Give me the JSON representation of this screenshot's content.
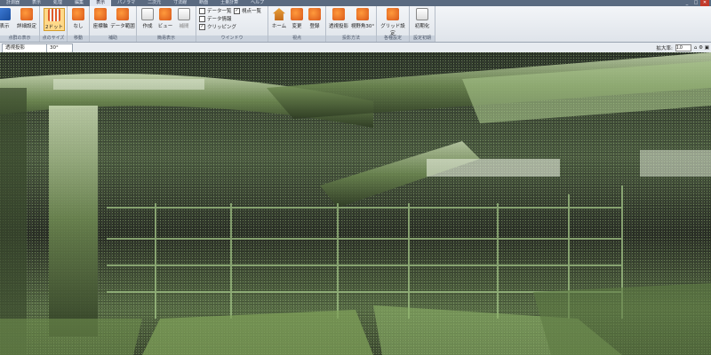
{
  "window": {
    "tabs": [
      "計測器",
      "表示",
      "処理",
      "編集",
      "表示",
      "パノラマ",
      "二次元",
      "寸法線",
      "断面",
      "土量計算",
      "ヘルプ"
    ],
    "active_tab_index": 4
  },
  "ribbon": {
    "groups": [
      {
        "caption": "点群の表示",
        "buttons": [
          "表示",
          "詳細設定"
        ]
      },
      {
        "caption": "点のサイズ",
        "buttons": [
          "2ドット"
        ]
      },
      {
        "caption": "移動",
        "buttons": [
          "なし"
        ]
      },
      {
        "caption": "補助",
        "buttons": [
          "座標軸",
          "データ範囲"
        ]
      },
      {
        "caption": "簡易表示",
        "buttons": [
          "作成",
          "ビュー",
          "補間"
        ]
      },
      {
        "caption": "ウインドウ",
        "checks": [
          {
            "label": "データ一覧",
            "checked": false
          },
          {
            "label": "視点一覧",
            "checked": true
          },
          {
            "label": "データ情報",
            "checked": false
          },
          {
            "label": "クリッピング",
            "checked": true
          }
        ]
      },
      {
        "caption": "視点",
        "buttons": [
          "ホーム",
          "変更",
          "登録"
        ]
      },
      {
        "caption": "投影方法",
        "buttons": [
          "透視投影",
          "視野角30°"
        ]
      },
      {
        "caption": "各種設定",
        "buttons": [
          "グリッド設定"
        ]
      },
      {
        "caption": "設定初期",
        "buttons": [
          "初期化"
        ]
      }
    ]
  },
  "tabrow": {
    "doc_tab": "透視投影",
    "doc_tab2": "30°",
    "zoom_label": "拡大率:",
    "zoom_value": "1.0"
  }
}
